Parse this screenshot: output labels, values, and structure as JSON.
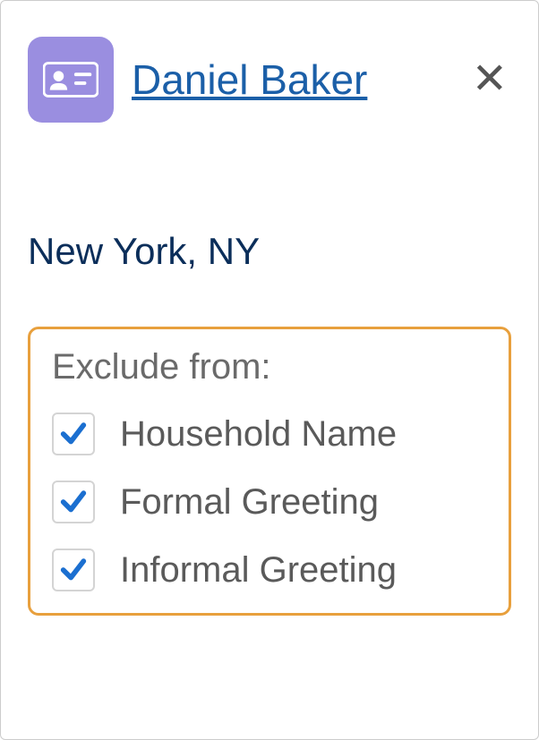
{
  "contact": {
    "name": "Daniel Baker",
    "location": "New York, NY"
  },
  "exclude": {
    "title": "Exclude from:",
    "options": [
      {
        "label": "Household Name",
        "checked": true
      },
      {
        "label": "Formal Greeting",
        "checked": true
      },
      {
        "label": "Informal Greeting",
        "checked": true
      }
    ]
  },
  "icons": {
    "contact": "contact-card",
    "close": "✕"
  },
  "colors": {
    "iconBg": "#9a8ee0",
    "link": "#1b5fa8",
    "panelBorder": "#e8a03d",
    "checkMark": "#1b6fd0"
  }
}
